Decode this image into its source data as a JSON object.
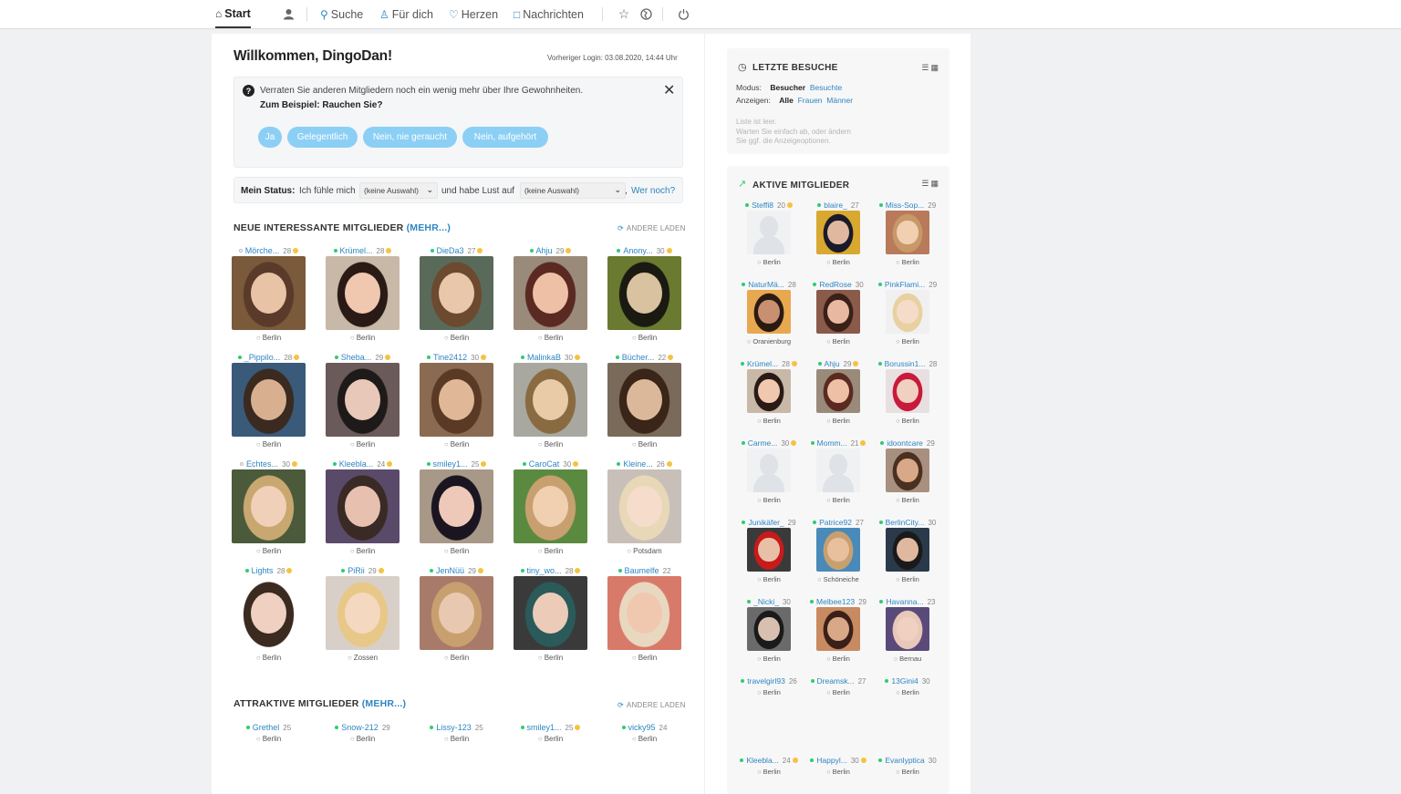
{
  "nav": {
    "start": "Start",
    "suche": "Suche",
    "fuer_dich": "Für dich",
    "herzen": "Herzen",
    "nachrichten": "Nachrichten"
  },
  "main": {
    "welcome": "Willkommen, DingoDan!",
    "last_login": "Vorheriger Login: 03.08.2020, 14:44 Uhr",
    "info_text": "Verraten Sie anderen Mitgliedern noch ein wenig mehr über Ihre Gewohnheiten.",
    "info_question": "Zum Beispiel: Rauchen Sie?",
    "answers": [
      "Ja",
      "Gelegentlich",
      "Nein, nie geraucht",
      "Nein, aufgehört"
    ],
    "status": {
      "label": "Mein Status:",
      "text1": "Ich fühle mich",
      "select1": "(keine Auswahl)",
      "text2": "und habe Lust auf",
      "select2": "(keine Auswahl)",
      "link": "Wer noch?"
    },
    "section1": {
      "title": "NEUE INTERESSANTE MITGLIEDER",
      "more": "(MEHR...)",
      "reload": "ANDERE LADEN"
    },
    "section2": {
      "title": "ATTRAKTIVE MITGLIEDER",
      "more": "(MEHR...)",
      "reload": "ANDERE LADEN"
    },
    "members": [
      {
        "name": "Mörche...",
        "age": "28",
        "city": "Berlin",
        "online": false,
        "star": true,
        "hair": "#5a3a2a",
        "skin": "#e8c3a6",
        "bg": "#7a5a3a"
      },
      {
        "name": "Krümel...",
        "age": "28",
        "city": "Berlin",
        "online": true,
        "star": true,
        "hair": "#2a1a15",
        "skin": "#f0c8b0",
        "bg": "#c8b8a8"
      },
      {
        "name": "DieDa3",
        "age": "27",
        "city": "Berlin",
        "online": true,
        "star": true,
        "hair": "#6b4a30",
        "skin": "#e9c7aa",
        "bg": "#5a6a5a"
      },
      {
        "name": "Ahju",
        "age": "29",
        "city": "Berlin",
        "online": true,
        "star": true,
        "hair": "#5a2a22",
        "skin": "#eec0a6",
        "bg": "#9a8a7a"
      },
      {
        "name": "Anony...",
        "age": "30",
        "city": "Berlin",
        "online": true,
        "star": true,
        "hair": "#1a1a12",
        "skin": "#d9c2a0",
        "bg": "#6a7a30"
      },
      {
        "name": "_Pippilo...",
        "age": "28",
        "city": "Berlin",
        "online": true,
        "star": true,
        "hair": "#3a2a20",
        "skin": "#d8b090",
        "bg": "#3a5a7a"
      },
      {
        "name": "Sheba...",
        "age": "29",
        "city": "Berlin",
        "online": true,
        "star": true,
        "hair": "#1f1a1a",
        "skin": "#e8c8b8",
        "bg": "#6a5a5a"
      },
      {
        "name": "Tine2412",
        "age": "30",
        "city": "Berlin",
        "online": true,
        "star": true,
        "hair": "#5a3a25",
        "skin": "#e0b898",
        "bg": "#8a6a50"
      },
      {
        "name": "MalinkaB",
        "age": "30",
        "city": "Berlin",
        "online": true,
        "star": true,
        "hair": "#8a6a40",
        "skin": "#eacba8",
        "bg": "#a8a8a0"
      },
      {
        "name": "Bücher...",
        "age": "22",
        "city": "Berlin",
        "online": true,
        "star": true,
        "hair": "#3a2518",
        "skin": "#dcb89a",
        "bg": "#7a6a5a"
      },
      {
        "name": "Echtes...",
        "age": "30",
        "city": "Berlin",
        "online": false,
        "star": true,
        "hair": "#c8a870",
        "skin": "#f0d0b8",
        "bg": "#4a5a3a"
      },
      {
        "name": "Kleebla...",
        "age": "24",
        "city": "Berlin",
        "online": true,
        "star": true,
        "hair": "#3a2a25",
        "skin": "#e8c0b0",
        "bg": "#5a4a6a"
      },
      {
        "name": "smiley1...",
        "age": "25",
        "city": "Berlin",
        "online": true,
        "star": true,
        "hair": "#1a1520",
        "skin": "#eec8b8",
        "bg": "#a89888"
      },
      {
        "name": "CaroCat",
        "age": "30",
        "city": "Berlin",
        "online": true,
        "star": true,
        "hair": "#c8a070",
        "skin": "#f0d0b0",
        "bg": "#5a8a40"
      },
      {
        "name": "Kleine...",
        "age": "26",
        "city": "Potsdam",
        "online": true,
        "star": true,
        "hair": "#e8d8b8",
        "skin": "#f5dccb",
        "bg": "#c8c0b8"
      },
      {
        "name": "Lights",
        "age": "28",
        "city": "Berlin",
        "online": true,
        "star": true,
        "hair": "#3a2a20",
        "skin": "#f0d0c0",
        "bg": "#ffffff"
      },
      {
        "name": "PiRii",
        "age": "29",
        "city": "Zossen",
        "online": true,
        "star": true,
        "hair": "#e8c888",
        "skin": "#f5d8c0",
        "bg": "#d8d0c8"
      },
      {
        "name": "JenNüü",
        "age": "29",
        "city": "Berlin",
        "online": true,
        "star": true,
        "hair": "#c8a070",
        "skin": "#e8c8b0",
        "bg": "#a87a6a"
      },
      {
        "name": "tiny_wo...",
        "age": "28",
        "city": "Berlin",
        "online": true,
        "star": true,
        "hair": "#2a5a5a",
        "skin": "#ecccb8",
        "bg": "#3a3a3a"
      },
      {
        "name": "Baumelfe",
        "age": "22",
        "city": "Berlin",
        "online": true,
        "star": false,
        "hair": "#e8d8c0",
        "skin": "#f0c8b0",
        "bg": "#d87a6a"
      }
    ],
    "attractive": [
      {
        "name": "Grethel",
        "age": "25",
        "city": "Berlin",
        "online": true,
        "star": false
      },
      {
        "name": "Snow-212",
        "age": "29",
        "city": "Berlin",
        "online": true,
        "star": false
      },
      {
        "name": "Lissy-123",
        "age": "25",
        "city": "Berlin",
        "online": true,
        "star": false
      },
      {
        "name": "smiley1...",
        "age": "25",
        "city": "Berlin",
        "online": true,
        "star": true
      },
      {
        "name": "vicky95",
        "age": "24",
        "city": "Berlin",
        "online": true,
        "star": false
      }
    ]
  },
  "side": {
    "visits": {
      "title": "LETZTE BESUCHE",
      "modus_label": "Modus:",
      "modus_active": "Besucher",
      "modus_link": "Besuchte",
      "anzeigen_label": "Anzeigen:",
      "anzeigen_active": "Alle",
      "anzeigen_link1": "Frauen",
      "anzeigen_link2": "Männer",
      "empty1": "Liste ist leer.",
      "empty2": "Warten Sie einfach ab, oder ändern",
      "empty3": "Sie ggf. die Anzeigeoptionen."
    },
    "active": {
      "title": "AKTIVE MITGLIEDER",
      "members": [
        {
          "name": "Steffi8",
          "age": "20",
          "city": "Berlin",
          "online": true,
          "star": true,
          "photo": false
        },
        {
          "name": "blaire_",
          "age": "27",
          "city": "Berlin",
          "online": true,
          "star": false,
          "photo": true,
          "hair": "#1a1a2a",
          "skin": "#e0b8a0",
          "bg": "#d8a830"
        },
        {
          "name": "Miss-Sop...",
          "age": "29",
          "city": "Berlin",
          "online": true,
          "star": false,
          "photo": true,
          "hair": "#c89868",
          "skin": "#f0d0b0",
          "bg": "#b87a5a"
        },
        {
          "name": "NaturMä...",
          "age": "28",
          "city": "Oranienburg",
          "online": true,
          "star": false,
          "photo": true,
          "hair": "#2a1a12",
          "skin": "#c89070",
          "bg": "#e8a850"
        },
        {
          "name": "RedRose",
          "age": "30",
          "city": "Berlin",
          "online": true,
          "star": false,
          "photo": true,
          "hair": "#3a2018",
          "skin": "#e8b8a0",
          "bg": "#8a5a4a"
        },
        {
          "name": "PinkFlami...",
          "age": "29",
          "city": "Berlin",
          "online": true,
          "star": false,
          "photo": true,
          "hair": "#e8d0a0",
          "skin": "#f5dcc8",
          "bg": "#f0f0f0"
        },
        {
          "name": "Krümel...",
          "age": "28",
          "city": "Berlin",
          "online": true,
          "star": true,
          "photo": true,
          "hair": "#2a1a15",
          "skin": "#f0c8b0",
          "bg": "#c8b8a8"
        },
        {
          "name": "Ahju",
          "age": "29",
          "city": "Berlin",
          "online": true,
          "star": true,
          "photo": true,
          "hair": "#5a2a22",
          "skin": "#eec0a6",
          "bg": "#9a8a7a"
        },
        {
          "name": "Borussin1...",
          "age": "28",
          "city": "Berlin",
          "online": true,
          "star": false,
          "photo": true,
          "hair": "#c81a3a",
          "skin": "#f0d0c0",
          "bg": "#e8e0e0"
        },
        {
          "name": "Carme...",
          "age": "30",
          "city": "Berlin",
          "online": true,
          "star": true,
          "photo": false
        },
        {
          "name": "Momm...",
          "age": "21",
          "city": "Berlin",
          "online": true,
          "star": true,
          "photo": false
        },
        {
          "name": "idoontcare",
          "age": "29",
          "city": "Berlin",
          "online": true,
          "star": false,
          "photo": true,
          "hair": "#4a3020",
          "skin": "#d8a888",
          "bg": "#a89080"
        },
        {
          "name": "Junikäfer_",
          "age": "29",
          "city": "Berlin",
          "online": true,
          "star": false,
          "photo": true,
          "hair": "#c81a1a",
          "skin": "#e8c0a8",
          "bg": "#3a3a3a"
        },
        {
          "name": "Patrice92",
          "age": "27",
          "city": "Schöneiche",
          "online": true,
          "star": false,
          "photo": true,
          "hair": "#c8a070",
          "skin": "#e8c0a0",
          "bg": "#4a8ab8"
        },
        {
          "name": "BerlinCity...",
          "age": "30",
          "city": "Berlin",
          "online": true,
          "star": false,
          "photo": true,
          "hair": "#1a1a1a",
          "skin": "#e0b8a0",
          "bg": "#2a3a4a"
        },
        {
          "name": "_Nicki_",
          "age": "30",
          "city": "Berlin",
          "online": true,
          "star": false,
          "photo": true,
          "hair": "#1a1a1a",
          "skin": "#d8c0b0",
          "bg": "#6a6a6a"
        },
        {
          "name": "Melbee123",
          "age": "29",
          "city": "Berlin",
          "online": true,
          "star": false,
          "photo": true,
          "hair": "#3a2018",
          "skin": "#d8a888",
          "bg": "#c88a60"
        },
        {
          "name": "Havanna...",
          "age": "23",
          "city": "Bernau",
          "online": true,
          "star": false,
          "photo": true,
          "hair": "#e8c8b8",
          "skin": "#f0d0c0",
          "bg": "#5a4a7a"
        },
        {
          "name": "travelgirl93",
          "age": "26",
          "city": "Berlin",
          "online": true,
          "star": false,
          "photo": null
        },
        {
          "name": "Dreamsk...",
          "age": "27",
          "city": "Berlin",
          "online": true,
          "star": false,
          "photo": null
        },
        {
          "name": "13Gini4",
          "age": "30",
          "city": "Berlin",
          "online": true,
          "star": false,
          "photo": null
        },
        {
          "name": "Kleebla...",
          "age": "24",
          "city": "Berlin",
          "online": true,
          "star": true,
          "photo": null
        },
        {
          "name": "Happyl...",
          "age": "30",
          "city": "Berlin",
          "online": true,
          "star": true,
          "photo": null
        },
        {
          "name": "Evanlyptica",
          "age": "30",
          "city": "Berlin",
          "online": true,
          "star": false,
          "photo": null
        }
      ]
    }
  },
  "icons": {
    "home": "home-icon",
    "profile": "user-icon",
    "search": "search-icon",
    "foryou": "person-plus-icon",
    "heart": "heart-icon",
    "messages": "speech-bubble-icon",
    "star": "star-icon",
    "globe": "globe-icon",
    "power": "power-icon"
  }
}
